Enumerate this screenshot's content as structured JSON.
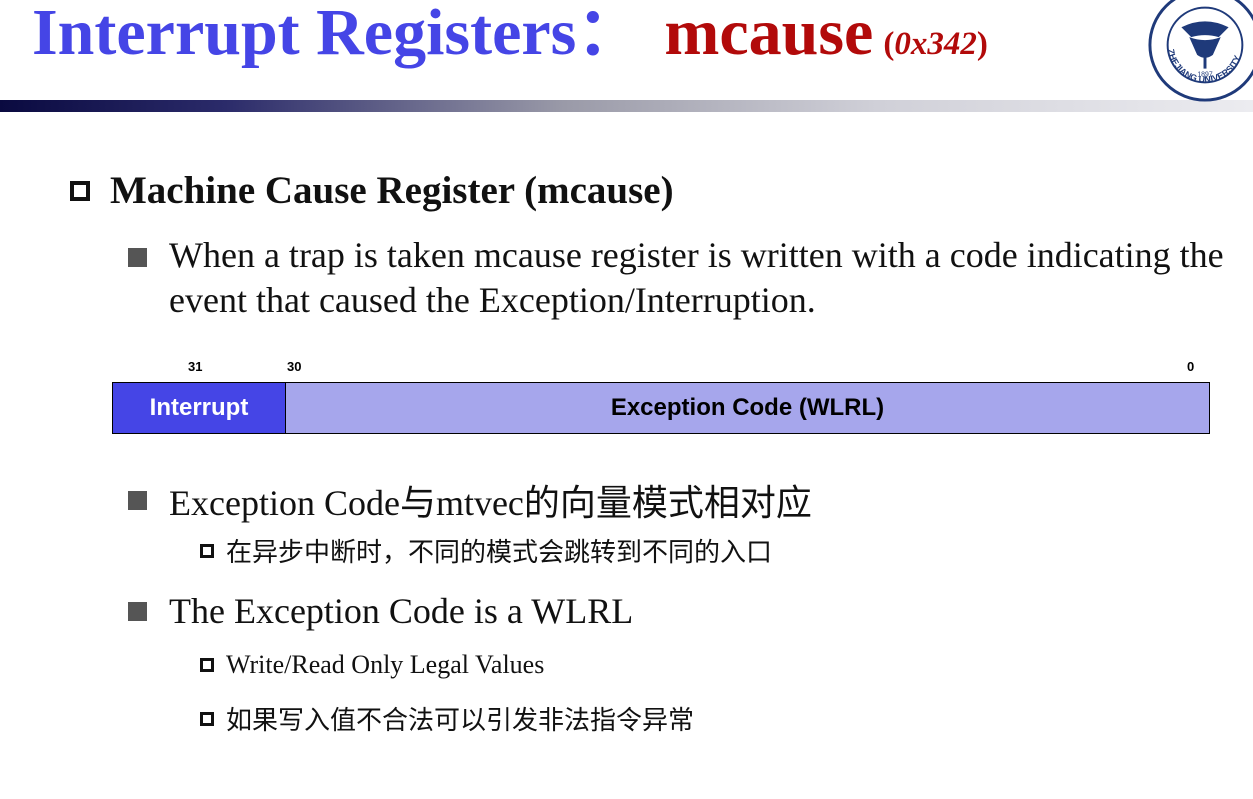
{
  "slide": {
    "title_main": "Interrupt Registers：",
    "title_register": "mcause",
    "title_addr_open": "(",
    "title_addr": "0x342",
    "title_addr_close": ")",
    "logo_text": "ZHEJIANG UNIVERSITY",
    "logo_year": "1897"
  },
  "bullets": {
    "heading": "Machine Cause Register (mcause)",
    "description": "When a trap is taken mcause register  is written with a code indicating the event that caused the Exception/Interruption."
  },
  "register_diagram": {
    "bit_31": "31",
    "bit_30": "30",
    "bit_0": "0",
    "field_interrupt": "Interrupt",
    "field_exception": "Exception Code (WLRL)"
  },
  "points": {
    "p1": "Exception Code与mtvec的向量模式相对应",
    "p1_sub1": "在异步中断时，不同的模式会跳转到不同的入口",
    "p2": "The Exception Code is a WLRL",
    "p2_sub1": "Write/Read Only Legal Values",
    "p2_sub2": "如果写入值不合法可以引发非法指令异常"
  },
  "colors": {
    "title_blue": "#4545e6",
    "title_red": "#b20a0a",
    "interrupt_field": "#4545e6",
    "exception_field": "#a6a6ec"
  }
}
